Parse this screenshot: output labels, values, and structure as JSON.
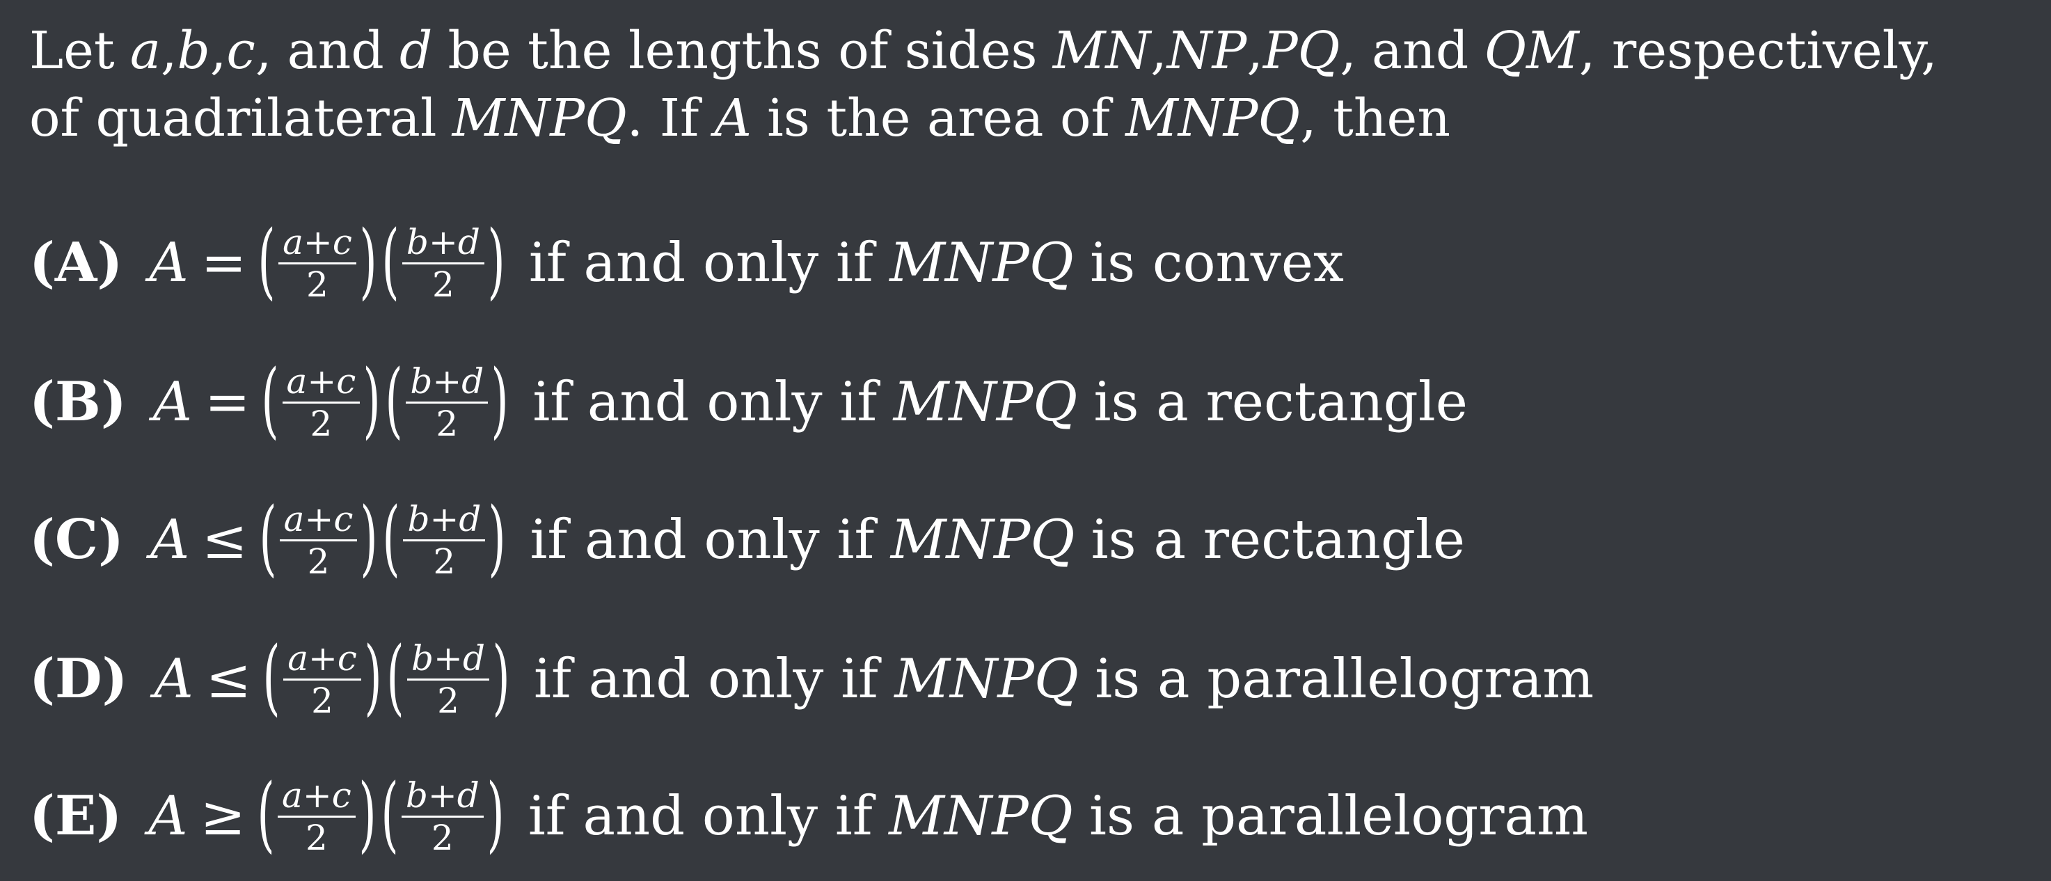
{
  "question": {
    "line1": {
      "t1": "Let",
      "a": "a",
      "c1": ",",
      "b": "b",
      "c2": ",",
      "c": "c",
      "c3": ",",
      "and1": "and",
      "d": "d",
      "t2": "be the lengths of sides",
      "s1": "MN",
      "c4": ",",
      "s2": "NP",
      "c5": ",",
      "s3": "PQ",
      "c6": ",",
      "and2": "and",
      "s4": "QM",
      "t3": ", respectively,"
    },
    "line2": {
      "t1": "of quadrilateral",
      "quad": "MNPQ",
      "t2": ". If",
      "area": "A",
      "t3": "is the area of",
      "quad2": "MNPQ",
      "t4": ", then"
    }
  },
  "fraction": {
    "num1_left": "a",
    "num1_op": "+",
    "num1_right": "c",
    "num2_left": "b",
    "num2_op": "+",
    "num2_right": "d",
    "den": "2",
    "open": "(",
    "close": ")"
  },
  "options": [
    {
      "letter": "(A)",
      "var": "A",
      "relation": "=",
      "mid": "if and only if",
      "quad": "MNPQ",
      "tail": "is convex"
    },
    {
      "letter": "(B)",
      "var": "A",
      "relation": "=",
      "mid": "if and only if",
      "quad": "MNPQ",
      "tail": "is a rectangle"
    },
    {
      "letter": "(C)",
      "var": "A",
      "relation": "≤",
      "mid": "if and only if",
      "quad": "MNPQ",
      "tail": "is a rectangle"
    },
    {
      "letter": "(D)",
      "var": "A",
      "relation": "≤",
      "mid": "if and only if",
      "quad": "MNPQ",
      "tail": "is a parallelogram"
    },
    {
      "letter": "(E)",
      "var": "A",
      "relation": "≥",
      "mid": "if and only if",
      "quad": "MNPQ",
      "tail": "is a parallelogram"
    }
  ]
}
